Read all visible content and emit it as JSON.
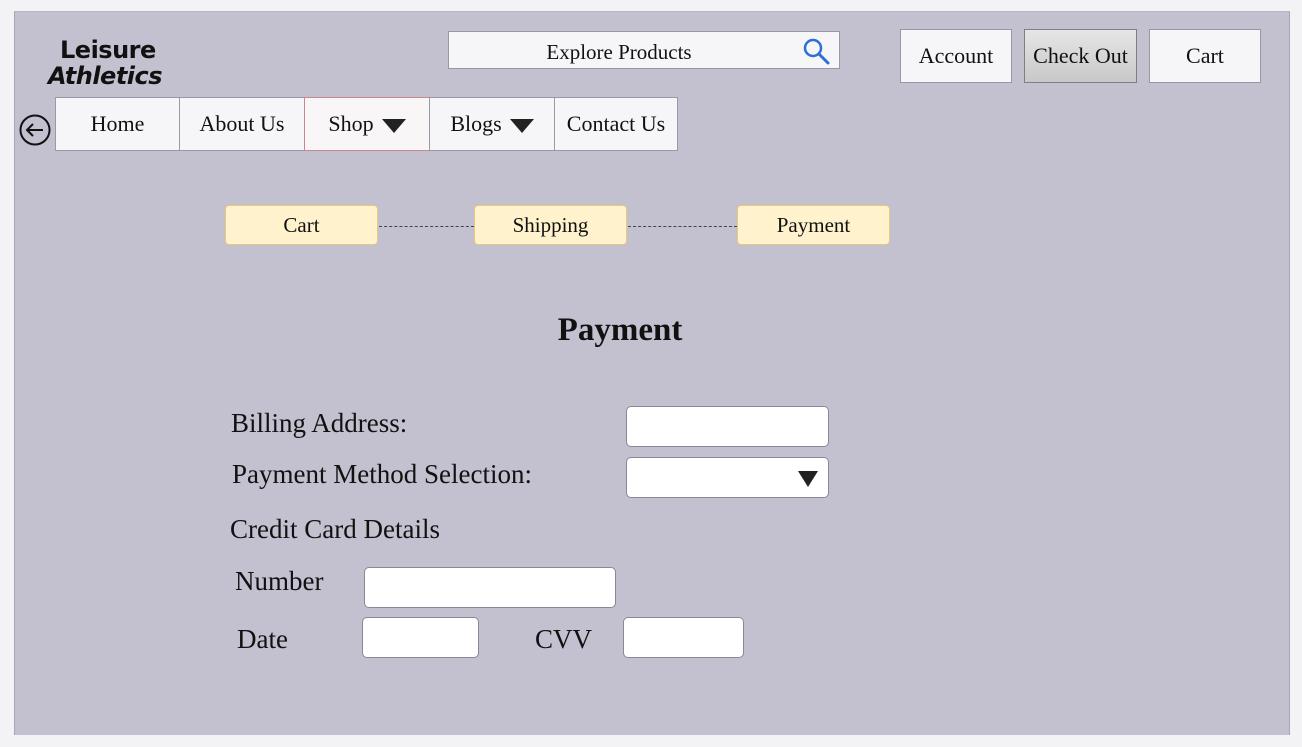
{
  "brand": {
    "line1": "Leisure",
    "line2": "Athletics"
  },
  "search": {
    "placeholder": "Explore Products",
    "icon": "search-icon"
  },
  "header_buttons": {
    "account": "Account",
    "checkout": "Check Out",
    "cart": "Cart"
  },
  "nav": {
    "back_icon": "back-arrow-circle-icon",
    "items": [
      {
        "label": "Home"
      },
      {
        "label": "About Us"
      },
      {
        "label": "Shop",
        "dropdown": true,
        "active": true
      },
      {
        "label": "Blogs",
        "dropdown": true
      },
      {
        "label": "Contact Us"
      }
    ]
  },
  "steps": [
    {
      "label": "Cart"
    },
    {
      "label": "Shipping"
    },
    {
      "label": "Payment"
    }
  ],
  "page_title": "Payment",
  "form": {
    "billing_address_label": "Billing Address:",
    "billing_address_value": "",
    "payment_method_label": "Payment Method Selection:",
    "payment_method_value": "",
    "credit_card_heading": "Credit Card Details",
    "number_label": "Number",
    "number_value": "",
    "date_label": "Date",
    "date_value": "",
    "cvv_label": "CVV",
    "cvv_value": ""
  },
  "colors": {
    "background": "#c3c0cf",
    "step_fill": "#fff2cc",
    "step_border": "#e8c87a",
    "active_nav_border": "#c9868c"
  }
}
